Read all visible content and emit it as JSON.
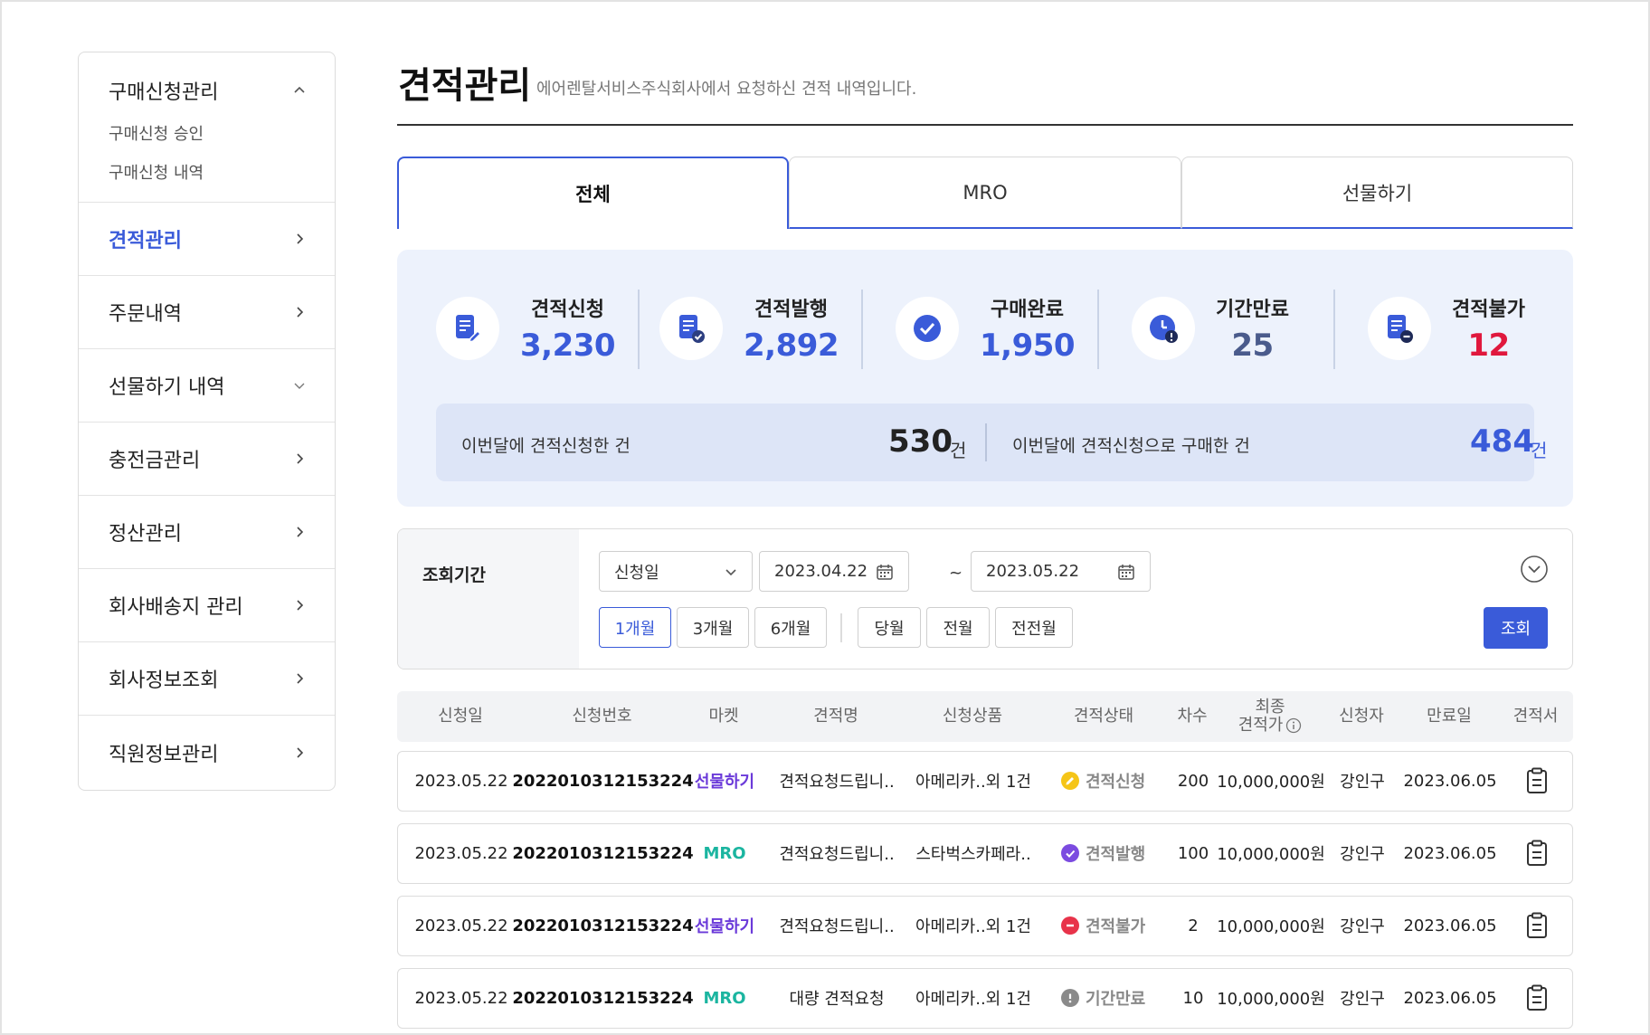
{
  "sidebar": {
    "group": {
      "title": "구매신청관리",
      "subs": [
        "구매신청 승인",
        "구매신청 내역"
      ]
    },
    "items": [
      {
        "label": "견적관리",
        "active": true,
        "chevron": "chevron-right-icon"
      },
      {
        "label": "주문내역",
        "active": false,
        "chevron": "chevron-right-icon"
      },
      {
        "label": "선물하기 내역",
        "active": false,
        "chevron": "chevron-down-icon"
      },
      {
        "label": "충전금관리",
        "active": false,
        "chevron": "chevron-right-icon"
      },
      {
        "label": "정산관리",
        "active": false,
        "chevron": "chevron-right-icon"
      },
      {
        "label": "회사배송지 관리",
        "active": false,
        "chevron": "chevron-right-icon"
      },
      {
        "label": "회사정보조회",
        "active": false,
        "chevron": "chevron-right-icon"
      },
      {
        "label": "직원정보관리",
        "active": false,
        "chevron": "chevron-right-icon"
      }
    ]
  },
  "header": {
    "title": "견적관리",
    "subtitle": "에어렌탈서비스주식회사에서 요청하신 견적 내역입니다."
  },
  "tabs": [
    {
      "label": "전체",
      "active": true
    },
    {
      "label": "MRO",
      "active": false
    },
    {
      "label": "선물하기",
      "active": false
    }
  ],
  "stats": [
    {
      "label": "견적신청",
      "value": "3,230",
      "icon": "quote-request-icon"
    },
    {
      "label": "견적발행",
      "value": "2,892",
      "icon": "quote-issued-icon"
    },
    {
      "label": "구매완료",
      "value": "1,950",
      "icon": "check-circle-icon"
    },
    {
      "label": "기간만료",
      "value": "25",
      "icon": "clock-alert-icon"
    },
    {
      "label": "견적불가",
      "value": "12",
      "icon": "quote-rejected-icon"
    }
  ],
  "month_summary": {
    "requested_label": "이번달에 견적신청한 건",
    "requested_value": "530",
    "purchased_label": "이번달에 견적신청으로 구매한 건",
    "purchased_value": "484",
    "unit": "건"
  },
  "filter": {
    "label": "조회기간",
    "date_type": "신청일",
    "start_date": "2023.04.22",
    "end_date": "2023.05.22",
    "separator": "~",
    "periods": [
      "1개월",
      "3개월",
      "6개월"
    ],
    "months": [
      "당월",
      "전월",
      "전전월"
    ],
    "search_label": "조회"
  },
  "table": {
    "headers": [
      "신청일",
      "신청번호",
      "마켓",
      "견적명",
      "신청상품",
      "견적상태",
      "차수",
      "최종",
      "견적가",
      "신청자",
      "만료일",
      "견적서"
    ],
    "rows": [
      {
        "date": "2023.05.22",
        "no": "2022010312153224",
        "market": "선물하기",
        "name": "견적요청드립니..",
        "product": "아메리카..외 1건",
        "status": "견적신청",
        "round": "200",
        "price": "10,000,000원",
        "requester": "강인구",
        "expire": "2023.06.05"
      },
      {
        "date": "2023.05.22",
        "no": "2022010312153224",
        "market": "MRO",
        "name": "견적요청드립니..",
        "product": "스타벅스카페라..",
        "status": "견적발행",
        "round": "100",
        "price": "10,000,000원",
        "requester": "강인구",
        "expire": "2023.06.05"
      },
      {
        "date": "2023.05.22",
        "no": "2022010312153224",
        "market": "선물하기",
        "name": "견적요청드립니..",
        "product": "아메리카..외 1건",
        "status": "견적불가",
        "round": "2",
        "price": "10,000,000원",
        "requester": "강인구",
        "expire": "2023.06.05"
      },
      {
        "date": "2023.05.22",
        "no": "2022010312153224",
        "market": "MRO",
        "name": "대량 견적요청",
        "product": "아메리카..외 1건",
        "status": "기간만료",
        "round": "10",
        "price": "10,000,000원",
        "requester": "강인구",
        "expire": "2023.06.05"
      }
    ]
  },
  "colors": {
    "accent": "#3a5bd9",
    "gift": "#6b3ad9",
    "mro": "#1bb5a0",
    "danger": "#e0183d",
    "status_request": "#f5c518",
    "status_issued": "#7b4be0",
    "status_rejected": "#e8334a",
    "status_expired": "#8a8a8a"
  }
}
